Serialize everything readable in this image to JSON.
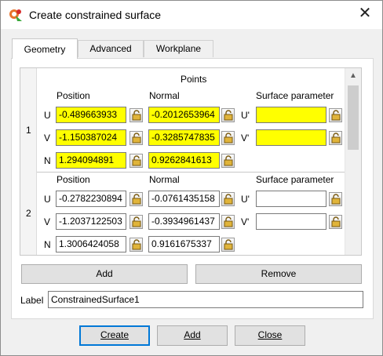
{
  "window": {
    "title": "Create constrained surface"
  },
  "tabs": [
    {
      "label": "Geometry",
      "active": true
    },
    {
      "label": "Advanced",
      "active": false
    },
    {
      "label": "Workplane",
      "active": false
    }
  ],
  "points": {
    "header": "Points",
    "col_position": "Position",
    "col_normal": "Normal",
    "col_surface": "Surface parameter",
    "rows": [
      {
        "number": "1",
        "U": {
          "label": "U",
          "position": "-0.489663933",
          "normal": "-0.2012653964",
          "param_label": "U'",
          "param": ""
        },
        "V": {
          "label": "V",
          "position": "-1.150387024",
          "normal": "-0.3285747835",
          "param_label": "V'",
          "param": ""
        },
        "N": {
          "label": "N",
          "position": "1.294094891",
          "normal": "0.9262841613"
        }
      },
      {
        "number": "2",
        "U": {
          "label": "U",
          "position": "-0.2782230894",
          "normal": "-0.0761435158",
          "param_label": "U'",
          "param": ""
        },
        "V": {
          "label": "V",
          "position": "-1.2037122503",
          "normal": "-0.3934961437",
          "param_label": "V'",
          "param": ""
        },
        "N": {
          "label": "N",
          "position": "1.3006424058",
          "normal": "0.9161675337"
        }
      }
    ]
  },
  "actions": {
    "add": "Add",
    "remove": "Remove"
  },
  "label_field": {
    "label": "Label",
    "value": "ConstrainedSurface1"
  },
  "footer": {
    "create": "Create",
    "add": "Add",
    "close": "Close"
  },
  "colors": {
    "highlight": "#ffff00",
    "accent": "#0078d7"
  }
}
